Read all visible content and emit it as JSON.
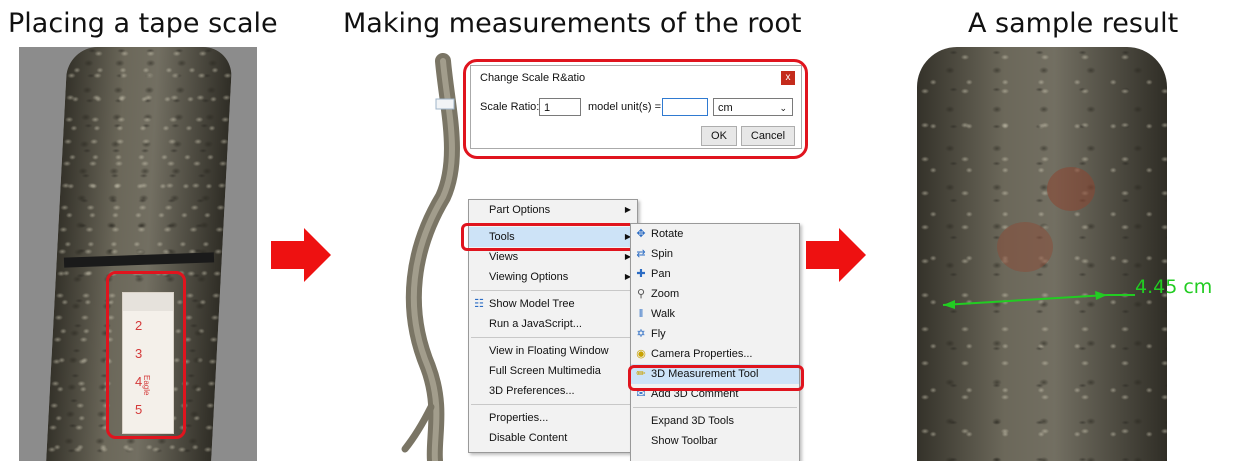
{
  "titles": {
    "left": "Placing a tape scale",
    "middle": "Making measurements of the root",
    "right": "A sample result"
  },
  "tape": {
    "marks": [
      "2",
      "3",
      "4",
      "5"
    ],
    "brand_text": "Eagle"
  },
  "dialog": {
    "title": "Change Scale R&atio",
    "scale_ratio_label": "Scale Ratio:",
    "scale_ratio_value": "1",
    "model_units_label": "model unit(s)  =",
    "units_value": "",
    "unit_select": "cm",
    "ok_label": "OK",
    "cancel_label": "Cancel",
    "close_label": "x"
  },
  "context_menu": {
    "items": [
      {
        "label": "Part Options",
        "submenu": true
      },
      {
        "label": "Tools",
        "submenu": true,
        "highlighted": true
      },
      {
        "label": "Views",
        "submenu": true
      },
      {
        "label": "Viewing Options",
        "submenu": true
      },
      {
        "label": "Show Model Tree",
        "icon": "model-tree-icon"
      },
      {
        "label": "Run a JavaScript..."
      },
      {
        "label": "View in Floating Window"
      },
      {
        "label": "Full Screen Multimedia"
      },
      {
        "label": "3D Preferences..."
      },
      {
        "label": "Properties..."
      },
      {
        "label": "Disable Content"
      }
    ]
  },
  "tools_submenu": {
    "items": [
      {
        "label": "Rotate",
        "icon": "rotate-icon"
      },
      {
        "label": "Spin",
        "icon": "spin-icon"
      },
      {
        "label": "Pan",
        "icon": "pan-icon"
      },
      {
        "label": "Zoom",
        "icon": "zoom-icon"
      },
      {
        "label": "Walk",
        "icon": "walk-icon"
      },
      {
        "label": "Fly",
        "icon": "fly-icon"
      },
      {
        "label": "Camera Properties...",
        "icon": "camera-icon"
      },
      {
        "label": "3D Measurement Tool",
        "icon": "ruler-icon",
        "highlighted": true
      },
      {
        "label": "Add 3D Comment",
        "icon": "comment-icon"
      },
      {
        "label": "Expand 3D Tools"
      },
      {
        "label": "Show Toolbar"
      }
    ]
  },
  "measurement": {
    "value_label": "4.45 cm",
    "color": "#22cc22"
  },
  "colors": {
    "accent_red": "#e0141e",
    "arrow_red": "#ee1111",
    "highlight": "#cde3f7"
  }
}
